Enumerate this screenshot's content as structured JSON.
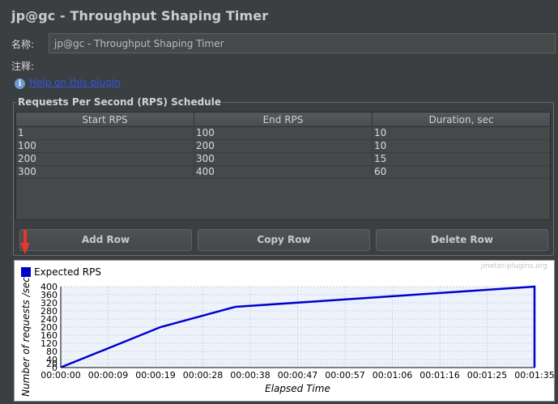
{
  "window": {
    "title": "jp@gc - Throughput Shaping Timer"
  },
  "form": {
    "name_label": "名称:",
    "name_value": "jp@gc - Throughput Shaping Timer",
    "comment_label": "注释:",
    "comment_value": "",
    "help_link": "Help on this plugin"
  },
  "schedule": {
    "title": "Requests Per Second (RPS) Schedule",
    "columns": [
      "Start RPS",
      "End RPS",
      "Duration, sec"
    ],
    "rows": [
      [
        "1",
        "100",
        "10"
      ],
      [
        "100",
        "200",
        "10"
      ],
      [
        "200",
        "300",
        "15"
      ],
      [
        "300",
        "400",
        "60"
      ]
    ],
    "buttons": {
      "add": "Add Row",
      "copy": "Copy Row",
      "delete": "Delete Row"
    }
  },
  "chart": {
    "watermark": "jmeter-plugins.org",
    "legend": "Expected RPS",
    "ylabel": "Number of requests /sec",
    "xlabel": "Elapsed Time",
    "series_color": "#0000cc"
  },
  "chart_data": {
    "type": "line",
    "xlabel": "Elapsed Time",
    "ylabel": "Number of requests /sec",
    "xlim": [
      0,
      95
    ],
    "ylim": [
      0,
      400
    ],
    "yticks": [
      0,
      20,
      40,
      80,
      120,
      160,
      200,
      240,
      280,
      320,
      360,
      400
    ],
    "xticks": [
      "00:00:00",
      "00:00:09",
      "00:00:19",
      "00:00:28",
      "00:00:38",
      "00:00:47",
      "00:00:57",
      "00:01:06",
      "00:01:16",
      "00:01:25",
      "00:01:35"
    ],
    "series": [
      {
        "name": "Expected RPS",
        "x": [
          0,
          10,
          20,
          35,
          95,
          95
        ],
        "y": [
          1,
          100,
          200,
          300,
          400,
          0
        ]
      }
    ],
    "grid": true,
    "legend_position": "top-left"
  }
}
